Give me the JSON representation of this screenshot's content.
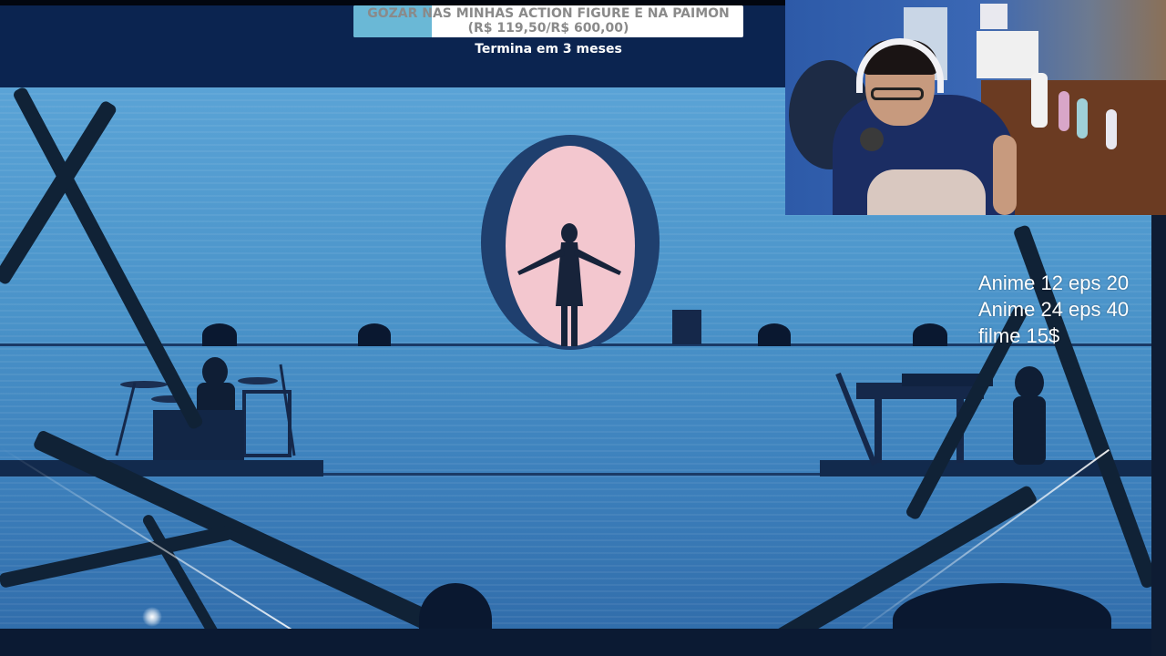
{
  "stream": {
    "goal": {
      "title": "GOZAR NAS MINHAS ACTION FIGURE E NA PAIMON",
      "amount": "(R$ 119,50/R$ 600,00)",
      "progress": 0.2,
      "subtitle": "Termina em 3 meses"
    },
    "price_list": [
      "Anime 12 eps 20",
      "Anime 24 eps 40",
      "filme 15$"
    ]
  },
  "colors": {
    "screen_blue": "#4a93c9",
    "mirror_pink": "#f3c7cf",
    "goal_fill": "#6ab8d6",
    "goal_bg": "#ffffff"
  },
  "icons": [
    "webcam-overlay",
    "concert-screen"
  ]
}
